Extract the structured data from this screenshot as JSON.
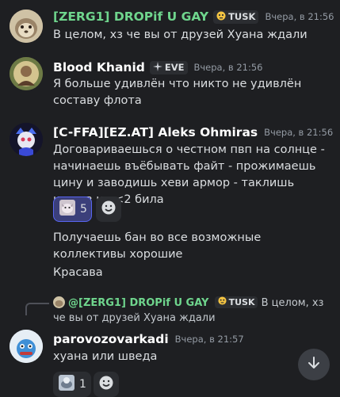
{
  "messages": [
    {
      "username": "[ZERG1] DROPif U GAY",
      "name_color": "#6fd58d",
      "badge": "TUSK",
      "badge_icon": "skull-face-icon",
      "timestamp": "Вчера, в 21:56",
      "text": "В целом, хз че вы от друзей Хуана ждали"
    },
    {
      "username": "Blood Khanid",
      "name_color": "#ffffff",
      "badge": "EVE",
      "badge_icon": "sparkle-icon",
      "timestamp": "Вчера, в 21:56",
      "text": "Я больше удивлён что никто не удивлён составу флота"
    },
    {
      "username": "[C-FFA][EZ.AT] Aleks Ohmiras",
      "name_color": "#ffffff",
      "timestamp": "Вчера, в 21:56",
      "text": "Договариваешься о честном пвп на солнце - начинаешь въёбывать файт - прожимаешь цину и заводишь хеви армор - таклишь шипов на <2 била",
      "reaction_count": "5",
      "follow_up_1": "Получаешь бан во все возможные коллективы хорошие",
      "follow_up_2": "Красава"
    },
    {
      "username": "parovozovarkadi",
      "name_color": "#ffffff",
      "timestamp": "Вчера, в 21:57",
      "text": "хуана или шведа",
      "reaction_count": "1",
      "reply": {
        "username": "@[ZERG1] DROPif U GAY",
        "badge": "TUSK",
        "text": "В целом, хз че вы от друзей Хуана ждали"
      }
    }
  ]
}
